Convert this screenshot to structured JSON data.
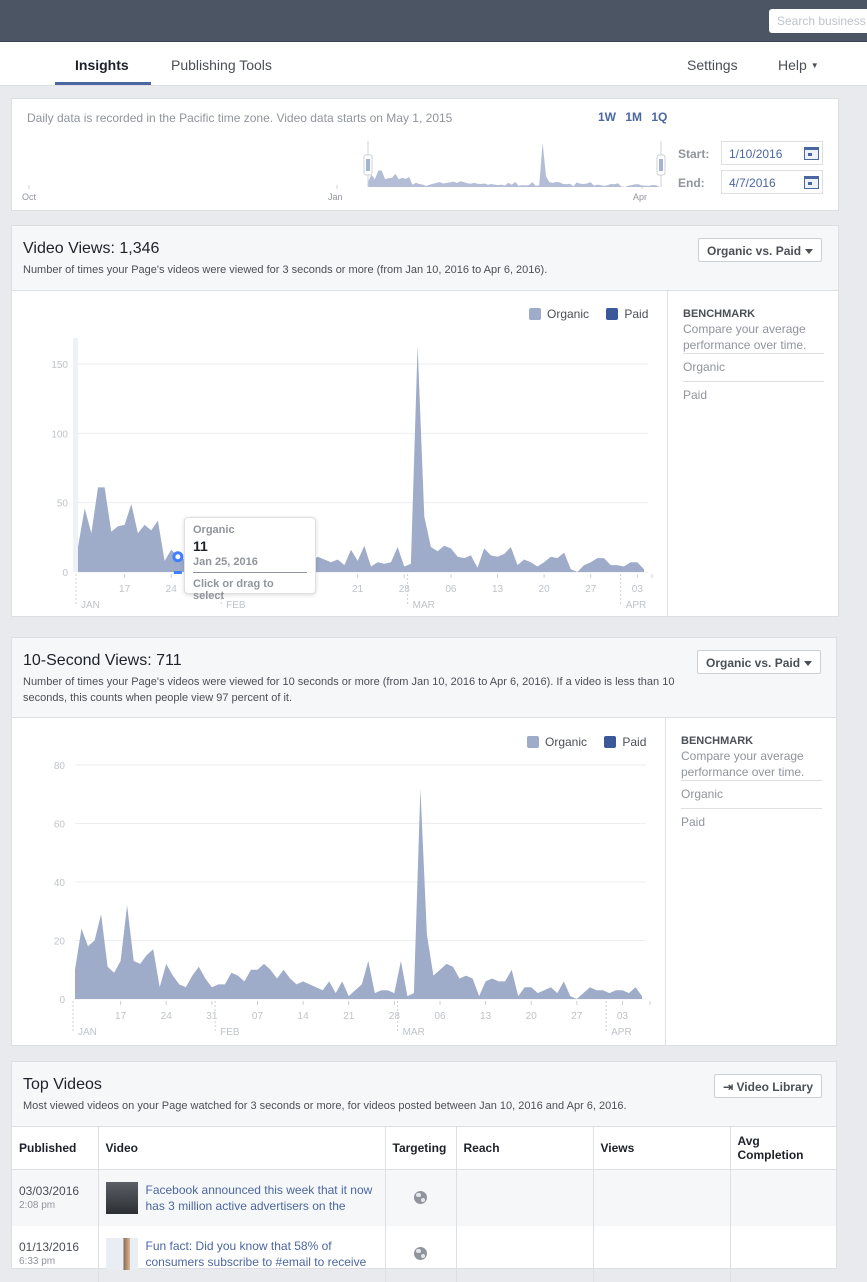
{
  "topbar": {
    "search_placeholder": "Search business"
  },
  "nav": {
    "tabs": [
      {
        "label": "Insights",
        "active": true
      },
      {
        "label": "Publishing Tools",
        "active": false
      }
    ],
    "settings": "Settings",
    "help": "Help"
  },
  "range": {
    "note": "Daily data is recorded in the Pacific time zone. Video data starts on May 1, 2015",
    "presets": [
      "1W",
      "1M",
      "1Q"
    ],
    "start_label": "Start:",
    "start_value": "1/10/2016",
    "end_label": "End:",
    "end_value": "4/7/2016",
    "axis_labels": [
      "Oct",
      "Jan",
      "Apr"
    ]
  },
  "video_views": {
    "title": "Video Views: 1,346",
    "description": "Number of times your Page's videos were viewed for 3 seconds or more (from Jan 10, 2016 to Apr 6, 2016).",
    "dropdown": "Organic vs. Paid",
    "legend": [
      "Organic",
      "Paid"
    ],
    "tooltip": {
      "series": "Organic",
      "value": "11",
      "date": "Jan 25, 2016",
      "hint": "Click or drag to select"
    }
  },
  "ten_second_views": {
    "title": "10-Second Views: 711",
    "description": "Number of times your Page's videos were viewed for 10 seconds or more (from Jan 10, 2016 to Apr 6, 2016). If a video is less than 10 seconds, this counts when people view 97 percent of it.",
    "dropdown": "Organic vs. Paid",
    "legend": [
      "Organic",
      "Paid"
    ]
  },
  "benchmark": {
    "title": "BENCHMARK",
    "description": "Compare your average performance over time.",
    "options": [
      "Organic",
      "Paid"
    ]
  },
  "colors": {
    "organic": "#9eabc9",
    "paid": "#3b5998",
    "accent": "#4b67a1"
  },
  "chart_data": [
    {
      "type": "area",
      "title": "Video Views: 1,346",
      "x_start": "2016-01-10",
      "x_tick_labels": [
        "17",
        "24",
        "31",
        "07",
        "14",
        "21",
        "28",
        "06",
        "13",
        "20",
        "27",
        "03"
      ],
      "month_labels": [
        "JAN",
        "FEB",
        "MAR",
        "APR"
      ],
      "yticks": [
        0,
        50,
        100,
        150
      ],
      "ylim": [
        0,
        170
      ],
      "series": [
        {
          "name": "Organic",
          "values": [
            18,
            46,
            28,
            61,
            61,
            29,
            33,
            34,
            49,
            28,
            34,
            30,
            37,
            8,
            16,
            11,
            9,
            4,
            8,
            12,
            15,
            18,
            13,
            15,
            17,
            20,
            15,
            21,
            18,
            14,
            12,
            15,
            12,
            11,
            13,
            8,
            11,
            9,
            7,
            9,
            5,
            16,
            8,
            19,
            4,
            7,
            6,
            7,
            18,
            4,
            6,
            163,
            40,
            18,
            15,
            19,
            17,
            11,
            10,
            12,
            3,
            17,
            12,
            11,
            13,
            18,
            5,
            9,
            7,
            4,
            7,
            11,
            10,
            14,
            2,
            0,
            5,
            7,
            10,
            10,
            5,
            5,
            4,
            7,
            7,
            2
          ],
          "note": "values approximate, read from chart"
        },
        {
          "name": "Paid",
          "values": []
        }
      ]
    },
    {
      "type": "area",
      "title": "10-Second Views: 711",
      "x_start": "2016-01-10",
      "x_tick_labels": [
        "17",
        "24",
        "31",
        "07",
        "14",
        "21",
        "28",
        "06",
        "13",
        "20",
        "27",
        "03"
      ],
      "month_labels": [
        "JAN",
        "FEB",
        "MAR",
        "APR"
      ],
      "yticks": [
        0,
        20,
        40,
        60,
        80
      ],
      "ylim": [
        0,
        85
      ],
      "series": [
        {
          "name": "Organic",
          "values": [
            10,
            24,
            18,
            20,
            29,
            11,
            9,
            13,
            32,
            13,
            12,
            15,
            17,
            4,
            12,
            8,
            5,
            4,
            8,
            11,
            7,
            4,
            5,
            5,
            9,
            8,
            6,
            10,
            10,
            12,
            10,
            7,
            10,
            7,
            5,
            6,
            5,
            4,
            3,
            6,
            2,
            6,
            1,
            3,
            5,
            13,
            2,
            3,
            3,
            2,
            13,
            1,
            2,
            72,
            22,
            8,
            10,
            12,
            11,
            7,
            8,
            7,
            1,
            6,
            7,
            6,
            6,
            10,
            1,
            4,
            4,
            2,
            3,
            4,
            2,
            6,
            1,
            0,
            2,
            4,
            3,
            3,
            2,
            3,
            3,
            2,
            4,
            1
          ],
          "note": "values approximate, read from chart"
        },
        {
          "name": "Paid",
          "values": []
        }
      ]
    }
  ],
  "top_videos": {
    "title": "Top Videos",
    "description": "Most viewed videos on your Page watched for 3 seconds or more, for videos posted between Jan 10, 2016 and Apr 6, 2016.",
    "library_button": "Video Library",
    "columns": [
      "Published",
      "Video",
      "Targeting",
      "Reach",
      "Views",
      "Avg Completion"
    ],
    "rows": [
      {
        "date": "03/03/2016",
        "time": "2:08 pm",
        "title": "Facebook announced this week that it now has 3 million active advertisers on the",
        "targeting": "public",
        "reach": "",
        "views": "",
        "avg_completion": ""
      },
      {
        "date": "01/13/2016",
        "time": "6:33 pm",
        "title": "Fun fact: Did you know that 58% of consumers subscribe to #email to receive",
        "targeting": "public",
        "reach": "",
        "views": "",
        "avg_completion": ""
      }
    ]
  }
}
